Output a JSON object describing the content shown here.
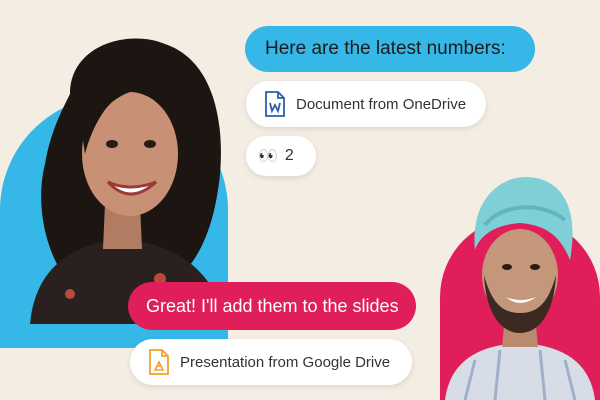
{
  "messages": {
    "incoming": {
      "text": "Here are the latest numbers:",
      "attachment": {
        "label": "Document from OneDrive",
        "icon": "word-document-icon"
      },
      "reaction": {
        "emoji": "👀",
        "count": "2"
      }
    },
    "outgoing": {
      "text": "Great! I'll add them to the slides",
      "attachment": {
        "label": "Presentation from Google Drive",
        "icon": "google-slides-icon"
      }
    }
  },
  "colors": {
    "background": "#f4ede3",
    "blue": "#35b8e8",
    "red": "#e01e5a",
    "onedrive_blue": "#2b5fa8",
    "slides_orange": "#f4a12b"
  }
}
